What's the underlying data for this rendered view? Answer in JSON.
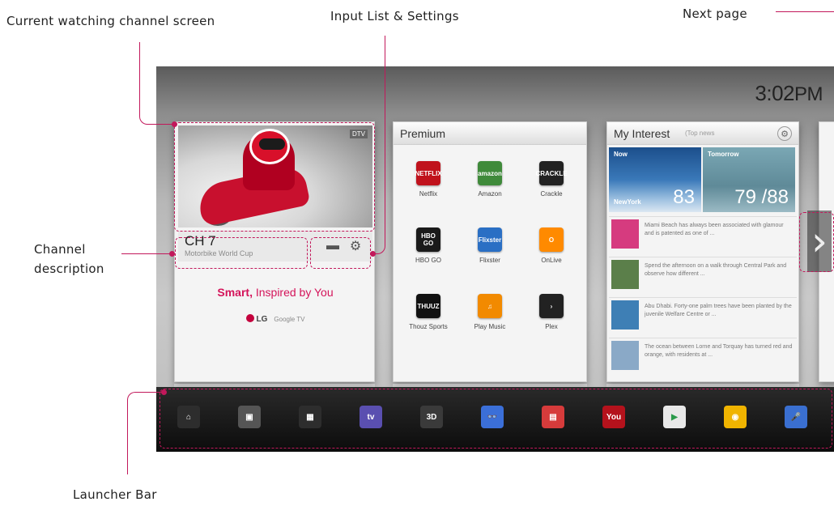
{
  "callouts": {
    "current_channel": "Current watching channel screen",
    "input_settings": "Input List & Settings",
    "next_page": "Next page",
    "channel_description_1": "Channel",
    "channel_description_2": "description",
    "launcher_bar": "Launcher Bar"
  },
  "clock": {
    "time": "3:02",
    "ampm": "PM"
  },
  "tv_card": {
    "tag": "DTV",
    "channel": "CH 7",
    "program": "Motorbike World Cup",
    "slogan_bold": "Smart,",
    "slogan_rest": " Inspired by You",
    "brand": "LG",
    "brand_sub": "Google TV"
  },
  "premium": {
    "title": "Premium",
    "apps": [
      {
        "label": "Netflix",
        "icon": "netflix-icon",
        "color": "#c0121c",
        "glyph": "NETFLIX"
      },
      {
        "label": "Amazon",
        "icon": "amazon-icon",
        "color": "#3f8a3a",
        "glyph": "amazon"
      },
      {
        "label": "Crackle",
        "icon": "crackle-icon",
        "color": "#222222",
        "glyph": "CRACKLE"
      },
      {
        "label": "HBO GO",
        "icon": "hbo-go-icon",
        "color": "#1a1a1a",
        "glyph": "HBO GO"
      },
      {
        "label": "Flixster",
        "icon": "flixster-icon",
        "color": "#2a6fc4",
        "glyph": "Flixster"
      },
      {
        "label": "OnLive",
        "icon": "onlive-icon",
        "color": "#ff8a00",
        "glyph": "O"
      },
      {
        "label": "Thouz Sports",
        "icon": "thouz-sports-icon",
        "color": "#111111",
        "glyph": "THUUZ"
      },
      {
        "label": "Play Music",
        "icon": "play-music-icon",
        "color": "#f28a00",
        "glyph": "♫"
      },
      {
        "label": "Plex",
        "icon": "plex-icon",
        "color": "#222222",
        "glyph": "›"
      }
    ]
  },
  "interest": {
    "title": "My Interest",
    "subtitle": "(Top news",
    "weather_now": {
      "tag": "Now",
      "temp": "83",
      "city": "NewYork"
    },
    "weather_tomorrow": {
      "tag": "Tomorrow",
      "temp": "79 /88"
    },
    "news": [
      {
        "text": "Miami Beach has always been associated with glamour and is patented as one of ...",
        "thumb": "#d63b7f"
      },
      {
        "text": "Spend the afternoon on a walk through Central Park and observe how different ...",
        "thumb": "#5b7f4a"
      },
      {
        "text": "Abu Dhabi. Forty-one palm trees have been planted by the juvenile Welfare Centre or ...",
        "thumb": "#3e7fb5"
      },
      {
        "text": "The ocean between Lorne and Torquay has turned red and orange, with residents at ...",
        "thumb": "#8aa9c7"
      }
    ]
  },
  "launcher": {
    "items": [
      {
        "name": "home-icon",
        "color": "#2d2d2d",
        "glyph": "⌂"
      },
      {
        "name": "tv-guide-icon",
        "color": "#555555",
        "glyph": "▣"
      },
      {
        "name": "apps-grid-icon",
        "color": "#2d2d2d",
        "glyph": "▦"
      },
      {
        "name": "live-tv-icon",
        "color": "#5a4fb0",
        "glyph": "tv"
      },
      {
        "name": "3d-icon",
        "color": "#3a3a3a",
        "glyph": "3D"
      },
      {
        "name": "3d-glasses-icon",
        "color": "#3b6fd8",
        "glyph": "👓"
      },
      {
        "name": "tv-channels-icon",
        "color": "#d63b3b",
        "glyph": "▤"
      },
      {
        "name": "youtube-icon",
        "color": "#b4121c",
        "glyph": "You"
      },
      {
        "name": "play-store-icon",
        "color": "#e8e8e8",
        "glyph": "▶"
      },
      {
        "name": "chrome-icon",
        "color": "#f0b400",
        "glyph": "◉"
      },
      {
        "name": "voice-search-icon",
        "color": "#3a6fd0",
        "glyph": "🎤"
      }
    ]
  }
}
